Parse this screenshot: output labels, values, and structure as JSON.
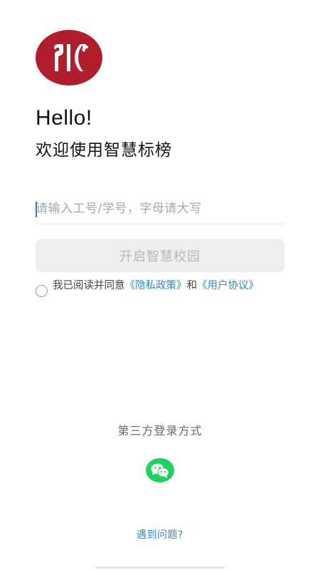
{
  "logo": {
    "icon": "school-emblem-icon",
    "color": "#b01e2e"
  },
  "greeting": {
    "hello": "Hello!",
    "welcome": "欢迎使用智慧标榜"
  },
  "login": {
    "account_placeholder": "请输入工号/学号，字母请大写",
    "account_value": "",
    "submit_label": "开启智慧校园"
  },
  "agreement": {
    "checked": false,
    "prefix": "我已阅读并同意",
    "privacy_link": "《隐私政策》",
    "and": "和",
    "user_link": "《用户协议》"
  },
  "third_party": {
    "title": "第三方登录方式",
    "wechat_icon": "wechat-icon",
    "wechat_color": "#1ed160"
  },
  "help_link": "遇到问题?"
}
